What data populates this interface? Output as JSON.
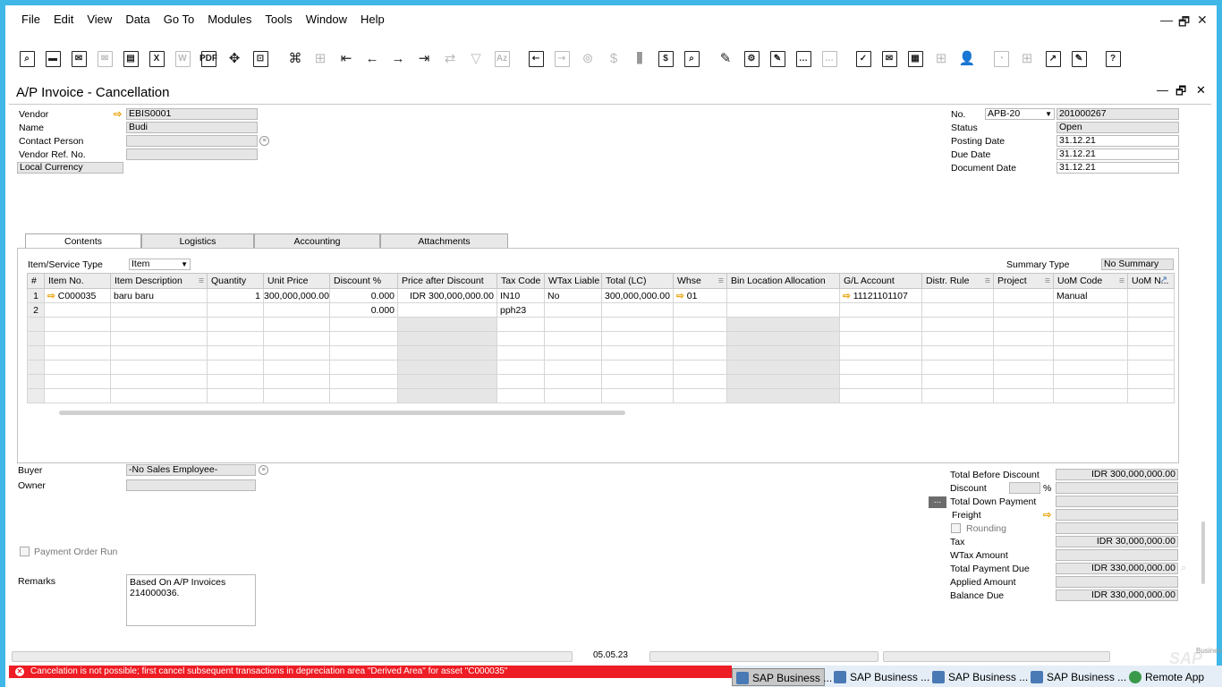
{
  "menu": [
    "File",
    "Edit",
    "View",
    "Data",
    "Go To",
    "Modules",
    "Tools",
    "Window",
    "Help"
  ],
  "window_controls": {
    "minimize": "—",
    "restore": "🗗",
    "close": "✕"
  },
  "document": {
    "title": "A/P Invoice - Cancellation"
  },
  "header_left": {
    "vendor_label": "Vendor",
    "vendor_value": "EBIS0001",
    "name_label": "Name",
    "name_value": "Budi",
    "contact_label": "Contact Person",
    "contact_value": "",
    "ref_label": "Vendor Ref. No.",
    "ref_value": "",
    "currency_value": "Local Currency"
  },
  "header_right": {
    "no_label": "No.",
    "series_value": "APB-20",
    "no_value": "201000267",
    "status_label": "Status",
    "status_value": "Open",
    "posting_label": "Posting Date",
    "posting_value": "31.12.21",
    "due_label": "Due Date",
    "due_value": "31.12.21",
    "docdate_label": "Document Date",
    "docdate_value": "31.12.21"
  },
  "tabs": [
    "Contents",
    "Logistics",
    "Accounting",
    "Attachments"
  ],
  "contents": {
    "type_label": "Item/Service Type",
    "type_value": "Item",
    "summary_label": "Summary Type",
    "summary_value": "No Summary",
    "columns": [
      "#",
      "Item No.",
      "Item Description",
      "Quantity",
      "Unit Price",
      "Discount %",
      "Price after Discount",
      "Tax Code",
      "WTax Liable",
      "Total (LC)",
      "Whse",
      "Bin Location Allocation",
      "G/L Account",
      "Distr. Rule",
      "Project",
      "UoM Code",
      "UoM N..."
    ],
    "rows": [
      {
        "num": "1",
        "item_no": "C000035",
        "desc": "baru baru",
        "qty": "1",
        "unit_price": "300,000,000.00",
        "discount": "0.000",
        "price_after": "IDR 300,000,000.00",
        "tax_code": "IN10",
        "wtax": "No",
        "total": "300,000,000.00",
        "whse": "01",
        "bin": "",
        "gl": "11121101107",
        "distr": "",
        "project": "",
        "uom": "Manual",
        "uom_name": ""
      },
      {
        "num": "2",
        "item_no": "",
        "desc": "",
        "qty": "",
        "unit_price": "",
        "discount": "0.000",
        "price_after": "",
        "tax_code": "pph23",
        "wtax": "",
        "total": "",
        "whse": "",
        "bin": "",
        "gl": "",
        "distr": "",
        "project": "",
        "uom": "",
        "uom_name": ""
      }
    ]
  },
  "footer_left": {
    "buyer_label": "Buyer",
    "buyer_value": "-No Sales Employee-",
    "owner_label": "Owner",
    "owner_value": "",
    "payment_order_label": "Payment Order Run",
    "remarks_label": "Remarks",
    "remarks_value": "Based On A/P Invoices\n214000036."
  },
  "totals": {
    "before_discount_label": "Total Before Discount",
    "before_discount_value": "IDR 300,000,000.00",
    "discount_label": "Discount",
    "discount_pct_sign": "%",
    "down_payment_label": "Total Down Payment",
    "dots": "...",
    "freight_label": "Freight",
    "rounding_label": "Rounding",
    "tax_label": "Tax",
    "tax_value": "IDR 30,000,000.00",
    "wtax_label": "WTax Amount",
    "payment_due_label": "Total Payment Due",
    "payment_due_value": "IDR 330,000,000.00",
    "applied_label": "Applied Amount",
    "balance_label": "Balance Due",
    "balance_value": "IDR 330,000,000.00"
  },
  "status_bar": {
    "date": "05.05.23",
    "sap": "SAP",
    "business": "Business"
  },
  "error": "Cancelation is not possible; first cancel subsequent transactions in depreciation area \"Derived Area\" for asset \"C000035\"",
  "taskbar": [
    "SAP Business ...",
    "SAP Business ...",
    "SAP Business ...",
    "SAP Business ...",
    "Remote App"
  ],
  "colors": {
    "accent": "#3fb8e8",
    "error": "#ee1c24",
    "arrow": "#e8a000"
  }
}
